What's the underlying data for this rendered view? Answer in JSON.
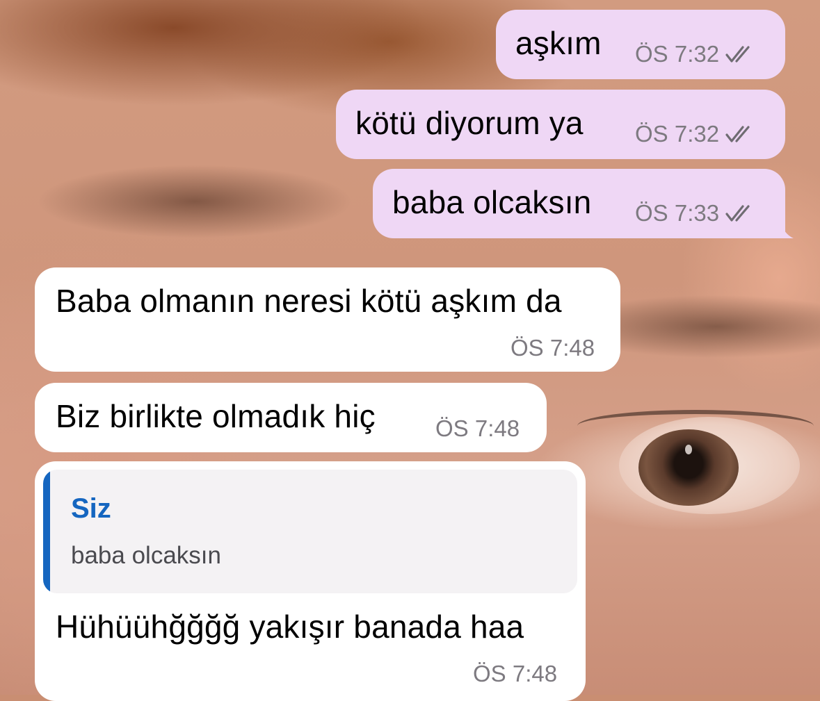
{
  "chat": {
    "outgoing": [
      {
        "text": "aşkım",
        "time": "ÖS 7:32",
        "status_icon": "double-check-icon"
      },
      {
        "text": "kötü diyorum ya",
        "time": "ÖS 7:32",
        "status_icon": "double-check-icon"
      },
      {
        "text": "baba olcaksın",
        "time": "ÖS 7:33",
        "status_icon": "double-check-icon"
      }
    ],
    "incoming": [
      {
        "text": "Baba olmanın neresi kötü aşkım da",
        "time": "ÖS 7:48"
      },
      {
        "text": "Biz birlikte olmadık hiç",
        "time": "ÖS 7:48"
      },
      {
        "reply_to": {
          "author": "Siz",
          "text": "baba olcaksın"
        },
        "text": "Hühüühğğğğ yakışır banada haa",
        "time": "ÖS 7:48"
      }
    ]
  },
  "colors": {
    "outgoing_bubble": "#efd7f5",
    "incoming_bubble": "#ffffff",
    "quote_accent": "#1566c0",
    "timestamp": "#7d7a80"
  }
}
